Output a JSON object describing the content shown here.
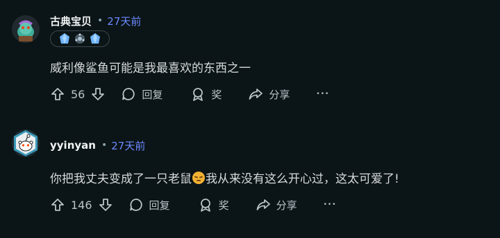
{
  "comments": [
    {
      "username": "古典宝贝",
      "separator": "•",
      "time": "27天前",
      "text": "威利像鲨鱼可能是我最喜欢的东西之一",
      "votes": "56",
      "reply_label": "回复",
      "award_label": "奖",
      "share_label": "分享",
      "more_label": "•••",
      "badges": [
        "crystal-badge-icon",
        "gear-badge-icon",
        "crystal-badge-icon"
      ]
    },
    {
      "username": "yyinyan",
      "separator": "•",
      "time": "27天前",
      "text_before": "你把我丈夫变成了一只老鼠",
      "text_after": "我从来没有这么开心过，这太可爱了!",
      "votes": "146",
      "reply_label": "回复",
      "award_label": "奖",
      "share_label": "分享",
      "more_label": "•••"
    }
  ],
  "colors": {
    "background": "#0b1416",
    "time": "#6c8bff",
    "text": "#d7dadc",
    "icon": "#b8c5c9"
  }
}
